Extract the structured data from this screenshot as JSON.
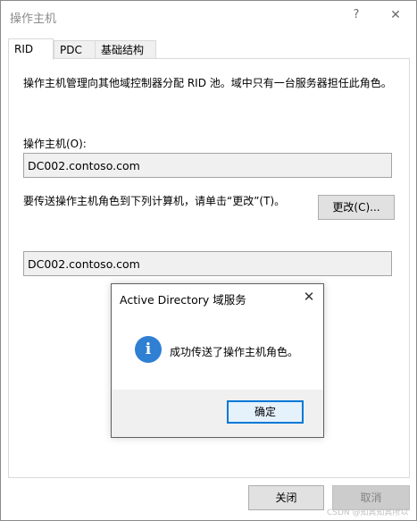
{
  "window": {
    "title": "操作主机",
    "help_label": "?",
    "close_label": "✕"
  },
  "tabs": [
    {
      "label": "RID",
      "active": true
    },
    {
      "label": "PDC",
      "active": false
    },
    {
      "label": "基础结构",
      "active": false
    }
  ],
  "rid_panel": {
    "description": "操作主机管理向其他域控制器分配 RID 池。域中只有一台服务器担任此角色。",
    "operations_master_label": "操作主机(O):",
    "operations_master_value": "DC002.contoso.com",
    "transfer_instruction": "要传送操作主机角色到下列计算机，请单击“更改”(T)。",
    "change_button_label": "更改(C)...",
    "target_computer_value": "DC002.contoso.com"
  },
  "footer": {
    "close_button_label": "关闭",
    "cancel_button_label": "取消"
  },
  "dialog": {
    "title": "Active Directory 域服务",
    "close_label": "✕",
    "icon": "info-icon",
    "message": "成功传送了操作主机角色。",
    "ok_button_label": "确定"
  },
  "watermark": "CSDN @知其知其所以"
}
